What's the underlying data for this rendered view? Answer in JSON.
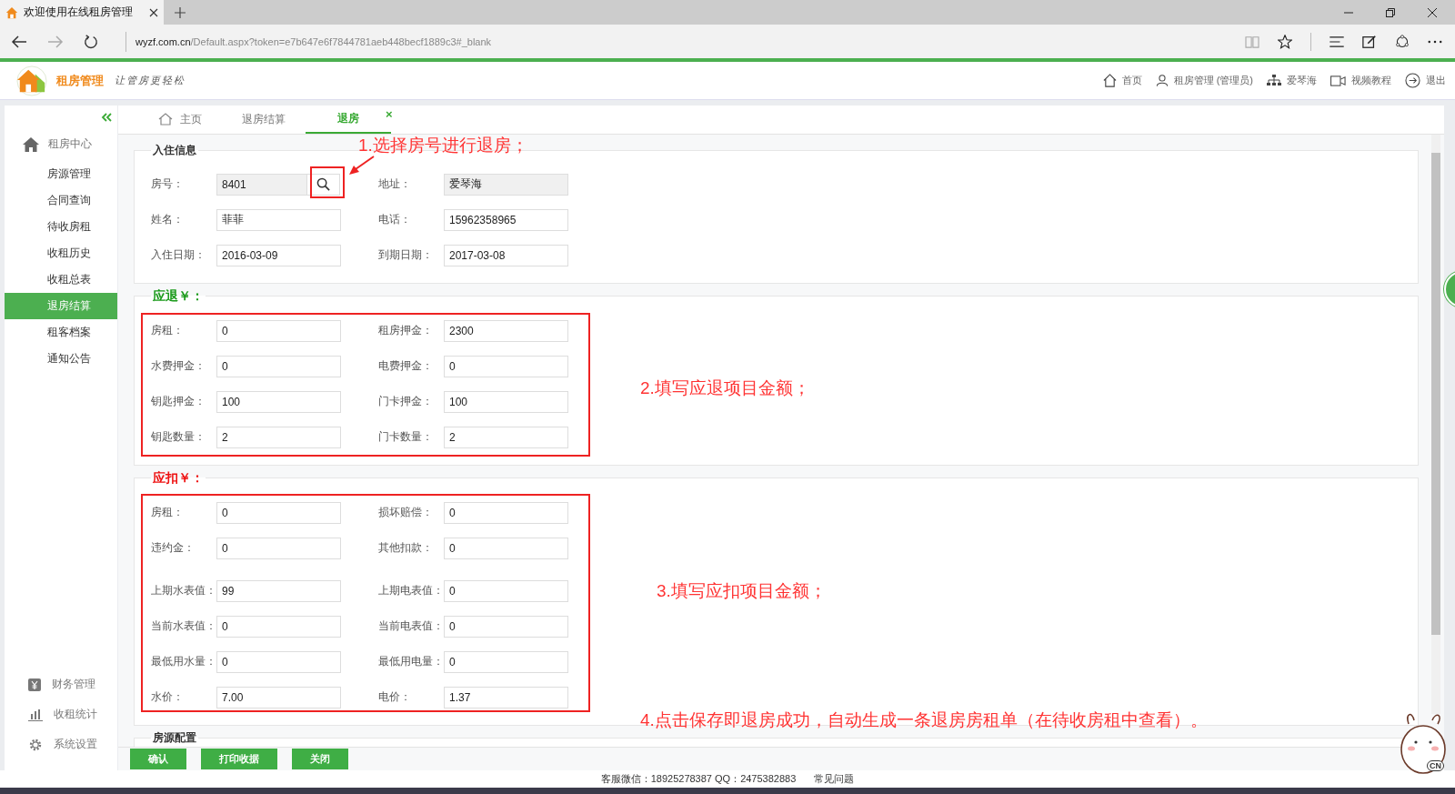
{
  "browser": {
    "tab_title": "欢迎使用在线租房管理",
    "url_host": "wyzf.com.cn",
    "url_path": "/Default.aspx?token=e7b647e6f7844781aeb448becf1889c3#_blank"
  },
  "header": {
    "brand": "租房管理",
    "slogan": "让管房更轻松",
    "nav": [
      {
        "kind": "home",
        "label": "首页"
      },
      {
        "kind": "user",
        "label": "租房管理 (管理员)"
      },
      {
        "kind": "org",
        "label": "爱琴海"
      },
      {
        "kind": "video",
        "label": "视频教程"
      },
      {
        "kind": "logout",
        "label": "退出"
      }
    ]
  },
  "sidebar": {
    "title": "租房中心",
    "items": [
      {
        "label": "房源管理",
        "selected": false
      },
      {
        "label": "合同查询",
        "selected": false
      },
      {
        "label": "待收房租",
        "selected": false
      },
      {
        "label": "收租历史",
        "selected": false
      },
      {
        "label": "收租总表",
        "selected": false
      },
      {
        "label": "退房结算",
        "selected": true
      },
      {
        "label": "租客档案",
        "selected": false
      },
      {
        "label": "通知公告",
        "selected": false
      }
    ],
    "groups": [
      {
        "kind": "finance",
        "label": "财务管理"
      },
      {
        "kind": "stats",
        "label": "收租统计"
      },
      {
        "kind": "settings",
        "label": "系统设置"
      }
    ]
  },
  "tabs": [
    {
      "kind": "home",
      "label": "主页",
      "selected": false
    },
    {
      "kind": "page",
      "label": "退房结算",
      "selected": false
    },
    {
      "kind": "page",
      "label": "退房",
      "selected": true,
      "close": "×"
    }
  ],
  "sections": [
    {
      "title": "入住信息",
      "color": "#333333",
      "groups": [
        [
          {
            "label": "房号：",
            "value": "8401",
            "kind": "lookup",
            "disabled": true
          },
          {
            "label": "地址：",
            "value": "爱琴海",
            "kind": "text",
            "disabled": true
          },
          {
            "label": "姓名：",
            "value": "菲菲",
            "kind": "text",
            "disabled": false
          },
          {
            "label": "电话：",
            "value": "15962358965",
            "kind": "text",
            "disabled": false
          },
          {
            "label": "入住日期：",
            "value": "2016-03-09",
            "kind": "text",
            "disabled": false
          },
          {
            "label": "到期日期：",
            "value": "2017-03-08",
            "kind": "text",
            "disabled": false
          }
        ]
      ]
    },
    {
      "title": "应退￥：",
      "color": "#1a9a1a",
      "groups": [
        [
          {
            "label": "房租：",
            "value": "0",
            "kind": "text",
            "disabled": false
          },
          {
            "label": "租房押金：",
            "value": "2300",
            "kind": "text",
            "disabled": false
          },
          {
            "label": "水费押金：",
            "value": "0",
            "kind": "text",
            "disabled": false
          },
          {
            "label": "电费押金：",
            "value": "0",
            "kind": "text",
            "disabled": false
          },
          {
            "label": "钥匙押金：",
            "value": "100",
            "kind": "text",
            "disabled": false
          },
          {
            "label": "门卡押金：",
            "value": "100",
            "kind": "text",
            "disabled": false
          },
          {
            "label": "钥匙数量：",
            "value": "2",
            "kind": "text",
            "disabled": false
          },
          {
            "label": "门卡数量：",
            "value": "2",
            "kind": "text",
            "disabled": false
          }
        ]
      ]
    },
    {
      "title": "应扣￥：",
      "color": "#ee1111",
      "groups": [
        [
          {
            "label": "房租：",
            "value": "0",
            "kind": "text",
            "disabled": false
          },
          {
            "label": "损坏赔偿：",
            "value": "0",
            "kind": "text",
            "disabled": false
          },
          {
            "label": "违约金：",
            "value": "0",
            "kind": "text",
            "disabled": false
          },
          {
            "label": "其他扣款：",
            "value": "0",
            "kind": "text",
            "disabled": false
          }
        ],
        [
          {
            "label": "上期水表值：",
            "value": "99",
            "kind": "text",
            "disabled": false
          },
          {
            "label": "上期电表值：",
            "value": "0",
            "kind": "text",
            "disabled": false
          },
          {
            "label": "当前水表值：",
            "value": "0",
            "kind": "text",
            "disabled": false
          },
          {
            "label": "当前电表值：",
            "value": "0",
            "kind": "text",
            "disabled": false
          },
          {
            "label": "最低用水量：",
            "value": "0",
            "kind": "text",
            "disabled": false
          },
          {
            "label": "最低用电量：",
            "value": "0",
            "kind": "text",
            "disabled": false
          },
          {
            "label": "水价：",
            "value": "7.00",
            "kind": "text",
            "disabled": false
          },
          {
            "label": "电价：",
            "value": "1.37",
            "kind": "text",
            "disabled": false
          }
        ]
      ]
    },
    {
      "title": "房源配置",
      "color": "#333333"
    }
  ],
  "buttons": [
    "确认",
    "打印收据",
    "关闭"
  ],
  "annotations": [
    {
      "text": "1.选择房号进行退房；"
    },
    {
      "text": "2.填写应退项目金额；"
    },
    {
      "text": "3.填写应扣项目金额；"
    },
    {
      "text": "4.点击保存即退房成功，自动生成一条退房房租单（在待收房租中查看）。"
    }
  ],
  "footer": {
    "contact": "客服微信：18925278387  QQ：2475382883",
    "link": "常见问题"
  },
  "sticker": {
    "label": "CN"
  }
}
